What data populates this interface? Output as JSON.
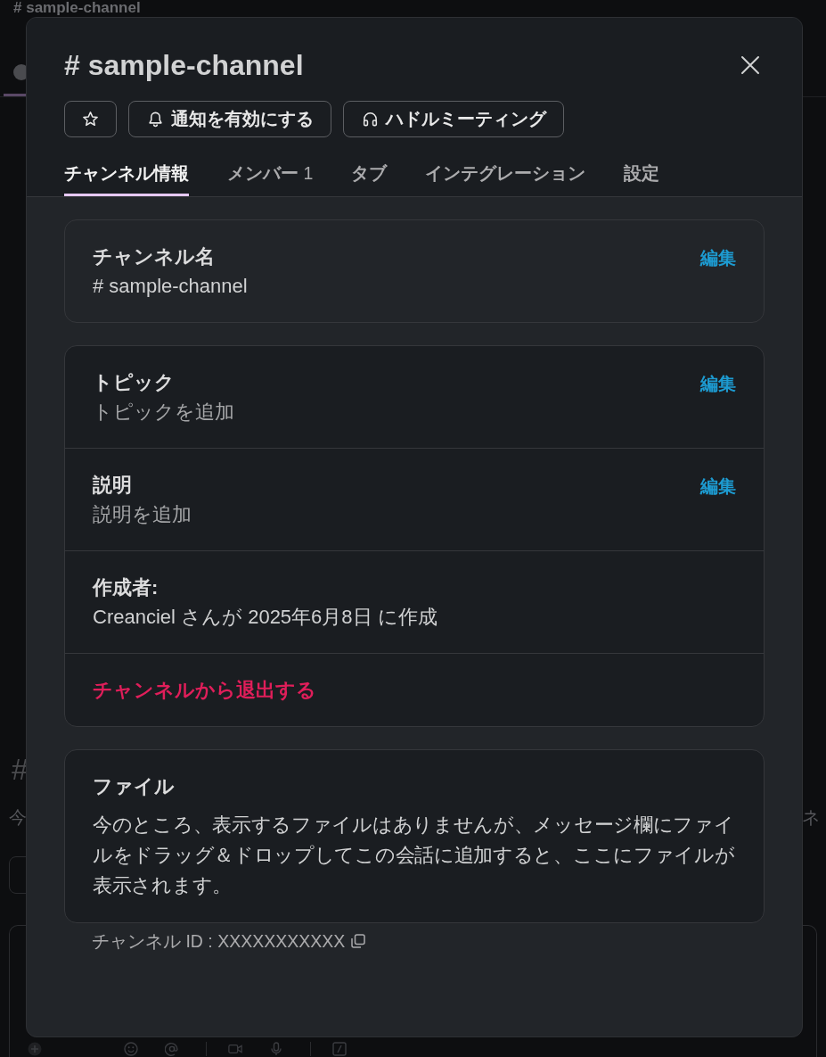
{
  "background": {
    "channel_title": "# sample-channel",
    "intro_heading": "#",
    "intro_text_left": "今",
    "intro_text_right": "ネ"
  },
  "modal": {
    "title": "# sample-channel",
    "actions": [
      {
        "kind": "star"
      },
      {
        "kind": "bell",
        "label": "通知を有効にする"
      },
      {
        "kind": "headphones",
        "label": "ハドルミーティング"
      }
    ],
    "tabs": [
      {
        "label": "チャンネル情報",
        "selected": true
      },
      {
        "label": "メンバー",
        "count": "1",
        "selected": false
      },
      {
        "label": "タブ",
        "selected": false
      },
      {
        "label": "インテグレーション",
        "selected": false
      },
      {
        "label": "設定",
        "selected": false
      }
    ],
    "sections": [
      {
        "kind": "plain",
        "rows": [
          {
            "kind": "field",
            "label": "チャンネル名",
            "value": "# sample-channel",
            "action": "編集"
          }
        ]
      },
      {
        "kind": "recessed",
        "rows": [
          {
            "kind": "empty_field",
            "label": "トピック",
            "value": "トピックを追加",
            "action": "編集"
          },
          {
            "kind": "empty_field",
            "label": "説明",
            "value": "説明を追加",
            "action": "編集"
          },
          {
            "kind": "field",
            "label": "作成者:",
            "value": "Creanciel さんが 2025年6月8日 に作成"
          },
          {
            "kind": "danger",
            "label": "チャンネルから退出する"
          }
        ]
      },
      {
        "kind": "recessed",
        "rows": [
          {
            "kind": "note",
            "label": "ファイル",
            "value": "今のところ、表示するファイルはありませんが、メッセージ欄にファイルをドラッグ＆ドロップしてこの会話に追加すると、ここにファイルが表示されます。"
          }
        ]
      }
    ],
    "channel_id": "チャンネル ID : XXXXXXXXXXX"
  }
}
